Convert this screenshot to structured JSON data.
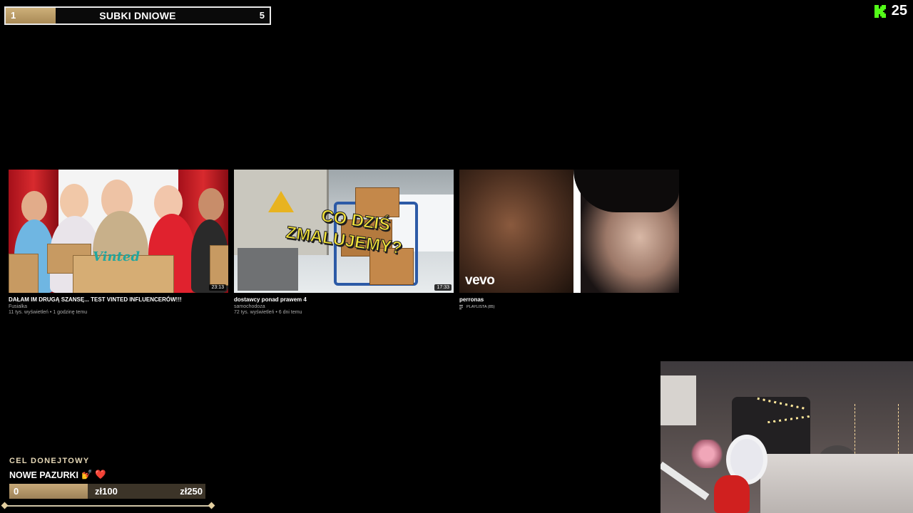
{
  "sub_goal": {
    "start": "1",
    "label": "SUBKI DNIOWE",
    "end": "5",
    "progress": 0.19
  },
  "kick": {
    "icon": "kick-logo-icon",
    "count": "25",
    "color": "#53fc18"
  },
  "videos": [
    {
      "title": "DAŁAM IM DRUGĄ SZANSĘ... TEST VINTED INFLUENCERÓW!!!",
      "channel": "Fusialka",
      "meta": "11 tys. wyświetleń • 1 godzinę temu",
      "duration": "23:13",
      "thumb_text": "Vinted"
    },
    {
      "title": "dostawcy ponad prawem 4",
      "channel": "samochodoza",
      "meta": "72 tys. wyświetleń • 6 dni temu",
      "duration": "17:33",
      "thumb_line1": "CO DZIŚ",
      "thumb_line2": "ZMALUJEMY?"
    },
    {
      "title": "perronas",
      "badge": "PLAYLISTA (85)",
      "badge_icon": "playlist-icon",
      "thumb_text": "vevo"
    }
  ],
  "donation_goal": {
    "title": "CEL DONEJTOWY",
    "name": "NOWE PAZURKI",
    "emojis": "💅 ❤️",
    "current": "0",
    "mid": "zł100",
    "target": "zł250",
    "accent": "#c7a978"
  }
}
